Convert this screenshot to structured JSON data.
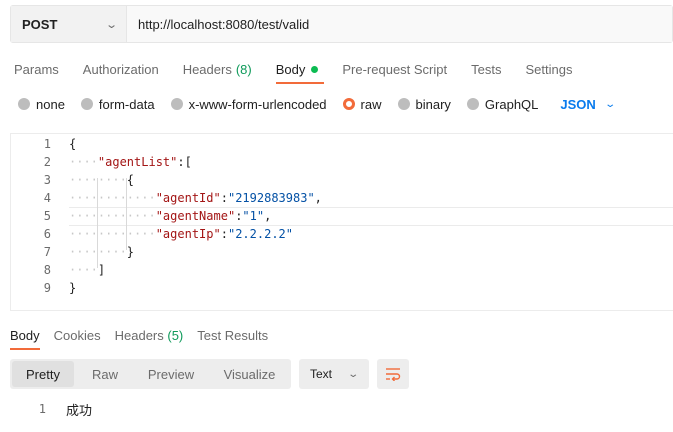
{
  "request": {
    "method": "POST",
    "url": "http://localhost:8080/test/valid"
  },
  "request_tabs": [
    {
      "label": "Params"
    },
    {
      "label": "Authorization"
    },
    {
      "label": "Headers",
      "count": "(8)"
    },
    {
      "label": "Body",
      "active": true
    },
    {
      "label": "Pre-request Script"
    },
    {
      "label": "Tests"
    },
    {
      "label": "Settings"
    }
  ],
  "body_modes": [
    "none",
    "form-data",
    "x-www-form-urlencoded",
    "raw",
    "binary",
    "GraphQL"
  ],
  "body_selected_mode": "raw",
  "body_format": "JSON",
  "editor": {
    "line_numbers": [
      "1",
      "2",
      "3",
      "4",
      "5",
      "6",
      "7",
      "8",
      "9"
    ],
    "lines": {
      "l1": "{",
      "l2_key": "\"agentList\"",
      "l2_rest": ":[",
      "l3": "{",
      "l4_key": "\"agentId\"",
      "l4_val": "\"2192883983\"",
      "l5_key": "\"agentName\"",
      "l5_val": "\"1\"",
      "l6_key": "\"agentIp\"",
      "l6_val": "\"2.2.2.2\"",
      "l7": "}",
      "l8": "]",
      "l9": "}"
    }
  },
  "response_tabs": [
    {
      "label": "Body",
      "active": true
    },
    {
      "label": "Cookies"
    },
    {
      "label": "Headers",
      "count": "(5)"
    },
    {
      "label": "Test Results"
    }
  ],
  "response_view": [
    "Pretty",
    "Raw",
    "Preview",
    "Visualize"
  ],
  "response_view_selected": "Pretty",
  "response_type": "Text",
  "response_body": {
    "line_number": "1",
    "text": "成功"
  },
  "colors": {
    "accent": "#f26b3a",
    "json_blue": "#097bed",
    "success_green": "#0cbb52"
  }
}
